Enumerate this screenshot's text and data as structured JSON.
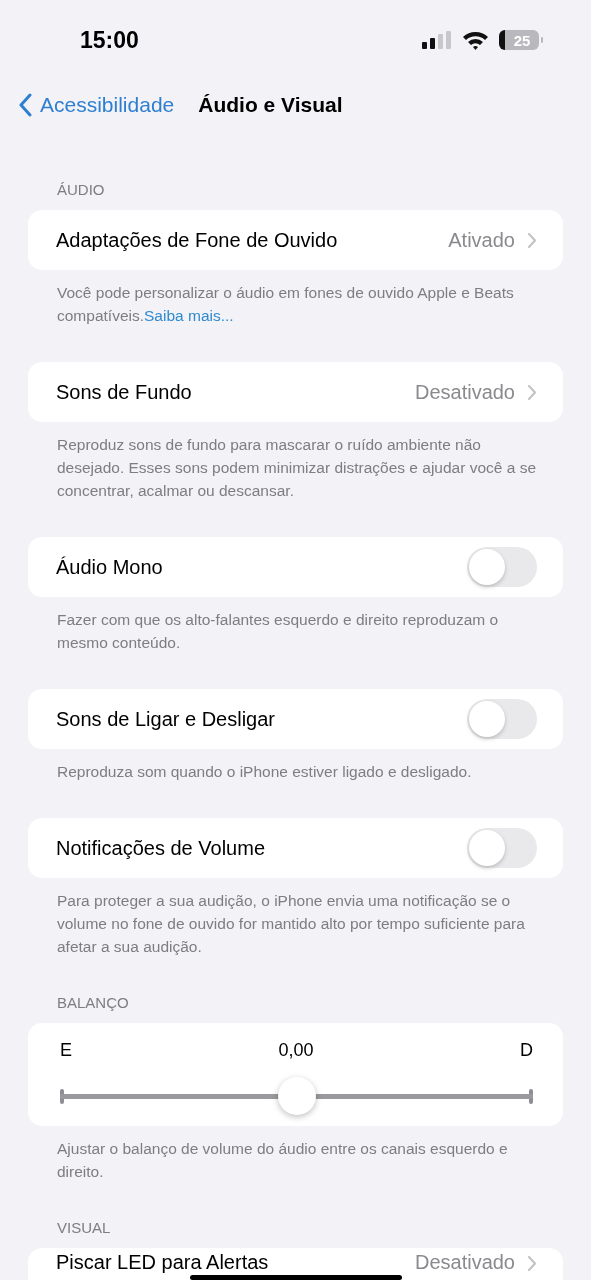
{
  "status_bar": {
    "time": "15:00",
    "battery": "25"
  },
  "nav": {
    "back": "Acessibilidade",
    "title": "Áudio e Visual"
  },
  "groups": [
    {
      "header": "ÁUDIO",
      "rows": [
        {
          "kind": "link",
          "label": "Adaptações de Fone de Ouvido",
          "value": "Ativado"
        }
      ],
      "footer": {
        "text": "Você pode personalizar o áudio em fones de ouvido Apple e Beats compatíveis.",
        "link": "Saiba mais..."
      }
    },
    {
      "rows": [
        {
          "kind": "link",
          "label": "Sons de Fundo",
          "value": "Desativado"
        }
      ],
      "footer": {
        "text": "Reproduz sons de fundo para mascarar o ruído ambiente não desejado. Esses sons podem minimizar distrações e ajudar você a se concentrar, acalmar ou descansar."
      }
    },
    {
      "rows": [
        {
          "kind": "toggle",
          "label": "Áudio Mono",
          "on": false
        }
      ],
      "footer": {
        "text": "Fazer com que os alto-falantes esquerdo e direito reproduzam o mesmo conteúdo."
      }
    },
    {
      "rows": [
        {
          "kind": "toggle",
          "label": "Sons de Ligar e Desligar",
          "on": false
        }
      ],
      "footer": {
        "text": "Reproduza som quando o iPhone estiver ligado e desligado."
      }
    },
    {
      "rows": [
        {
          "kind": "toggle",
          "label": "Notificações de Volume",
          "on": false
        }
      ],
      "footer": {
        "text": "Para proteger a sua audição, o iPhone envia uma notificação se o volume no fone de ouvido for mantido alto por tempo suficiente para afetar a sua audição."
      }
    },
    {
      "header": "BALANÇO",
      "rows": [
        {
          "kind": "balance",
          "left": "E",
          "reading": "0,00",
          "right": "D",
          "level": 0.5
        }
      ],
      "footer": {
        "text": "Ajustar o balanço de volume do áudio entre os canais esquerdo e direito."
      }
    },
    {
      "header": "VISUAL",
      "rows": [
        {
          "kind": "link",
          "label": "Piscar LED para Alertas",
          "value": "Desativado"
        }
      ]
    }
  ]
}
